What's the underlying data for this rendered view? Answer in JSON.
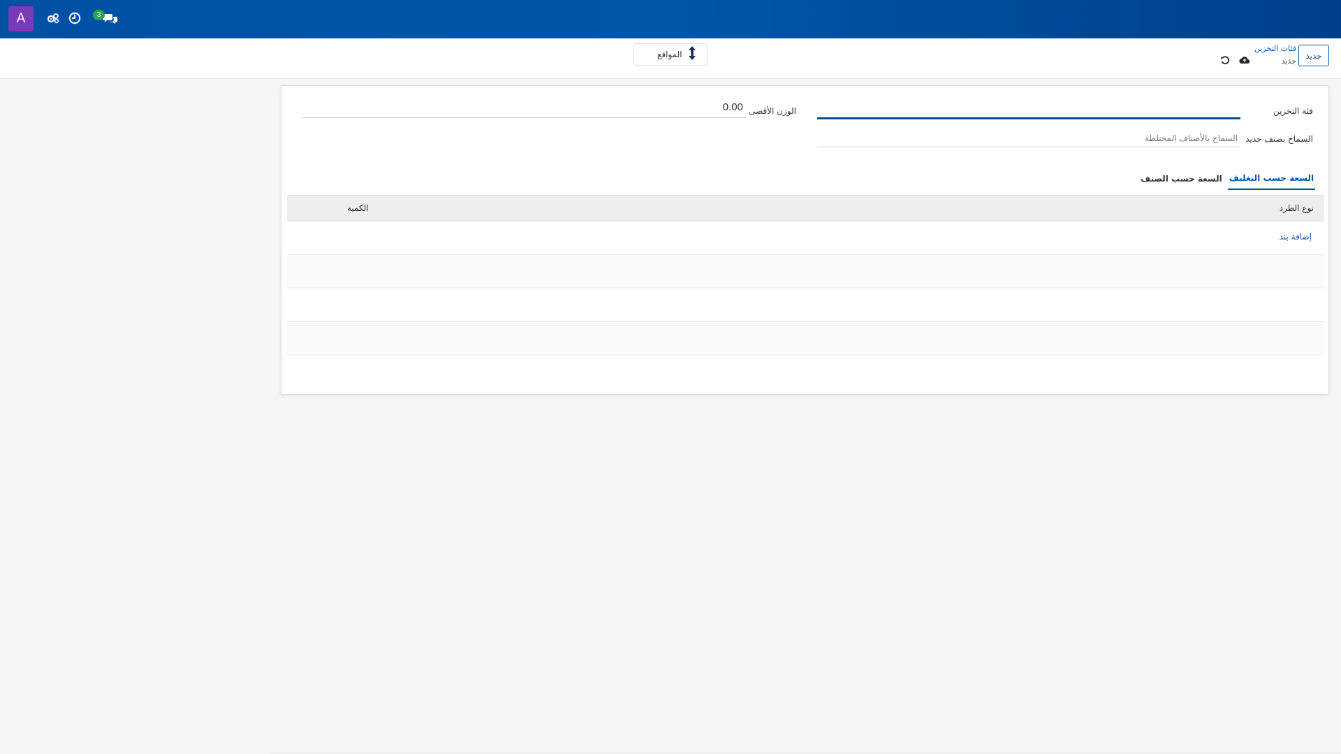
{
  "navbar": {
    "avatar_letter": "A",
    "icons": [
      "settings-cogs-icon",
      "clock-icon",
      "chat-icon"
    ],
    "chat_badge": "3",
    "accent": "#0050a4"
  },
  "control_panel": {
    "new_button": "جديد",
    "breadcrumb_parent": "فئات التخزين",
    "breadcrumb_current": "جديد",
    "locations_button": "المواقع"
  },
  "form": {
    "storage_category_label": "فئة التخزين",
    "storage_category_value": "",
    "max_weight_label": "الوزن الأقصى",
    "max_weight_value": "0.00",
    "allow_new_product_label": "السماح بصنف جديد",
    "allow_new_product_value": "السماح بالأصناف المختلطة"
  },
  "tabs": [
    {
      "label": "السعة حسب التغليف",
      "active": true
    },
    {
      "label": "السعة حسب الصنف",
      "active": false
    }
  ],
  "table": {
    "columns": [
      "نوع الطرد",
      "الكمية"
    ],
    "add_line": "إضافة بند"
  }
}
